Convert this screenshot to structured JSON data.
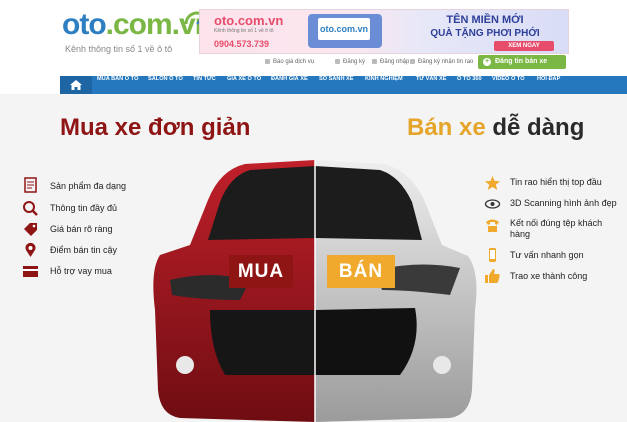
{
  "header": {
    "logo_text": "oto",
    "logo_suffix": ".com.vn",
    "tagline": "Kênh thông tin số 1 về ô tô"
  },
  "banner": {
    "logo": "oto.com.vn",
    "sub": "Kênh thông tin số 1 về ô tô",
    "phone": "0904.573.739",
    "device_text": "oto.com.vn",
    "line1": "TÊN MIỀN MỚI",
    "line2": "QUÀ TẶNG PHƠI PHỚI",
    "button": "XEM NGAY"
  },
  "utility_links": {
    "price": "Báo giá dịch vụ",
    "register": "Đăng ký",
    "login": "Đăng nhập",
    "news": "Đăng ký nhận tin rao",
    "post_button": "Đăng tin bán xe"
  },
  "nav": {
    "items": [
      "MUA BÁN Ô TÔ",
      "SALON Ô TÔ",
      "TIN TỨC",
      "GIÁ XE Ô TÔ",
      "ĐÁNH GIÁ XE",
      "SO SÁNH XE",
      "KINH NGHIỆM",
      "TƯ VẤN XE",
      "Ô TÔ 360",
      "VIDEO Ô TÔ",
      "HỎI ĐÁP"
    ]
  },
  "hero": {
    "left_title": "Mua xe đơn giản",
    "right_title_a": "Bán xe ",
    "right_title_b": "dễ dàng",
    "buy_label": "MUA",
    "sell_label": "BÁN",
    "left_features": [
      "Sản phẩm đa dạng",
      "Thông tin đầy đủ",
      "Giá bán rõ ràng",
      "Điểm bán tin cậy",
      "Hỗ trợ vay mua"
    ],
    "right_features": [
      "Tin rao hiển thị top đầu",
      "3D Scanning hình ảnh đẹp",
      "Kết nối đúng tệp khách",
      "hàng",
      "Tư vấn nhanh gọn",
      "Trao xe thành công"
    ]
  },
  "colors": {
    "brand_blue": "#2578be",
    "brand_green": "#7ab744",
    "buy_red": "#8f1414",
    "sell_orange": "#f0a92c"
  }
}
